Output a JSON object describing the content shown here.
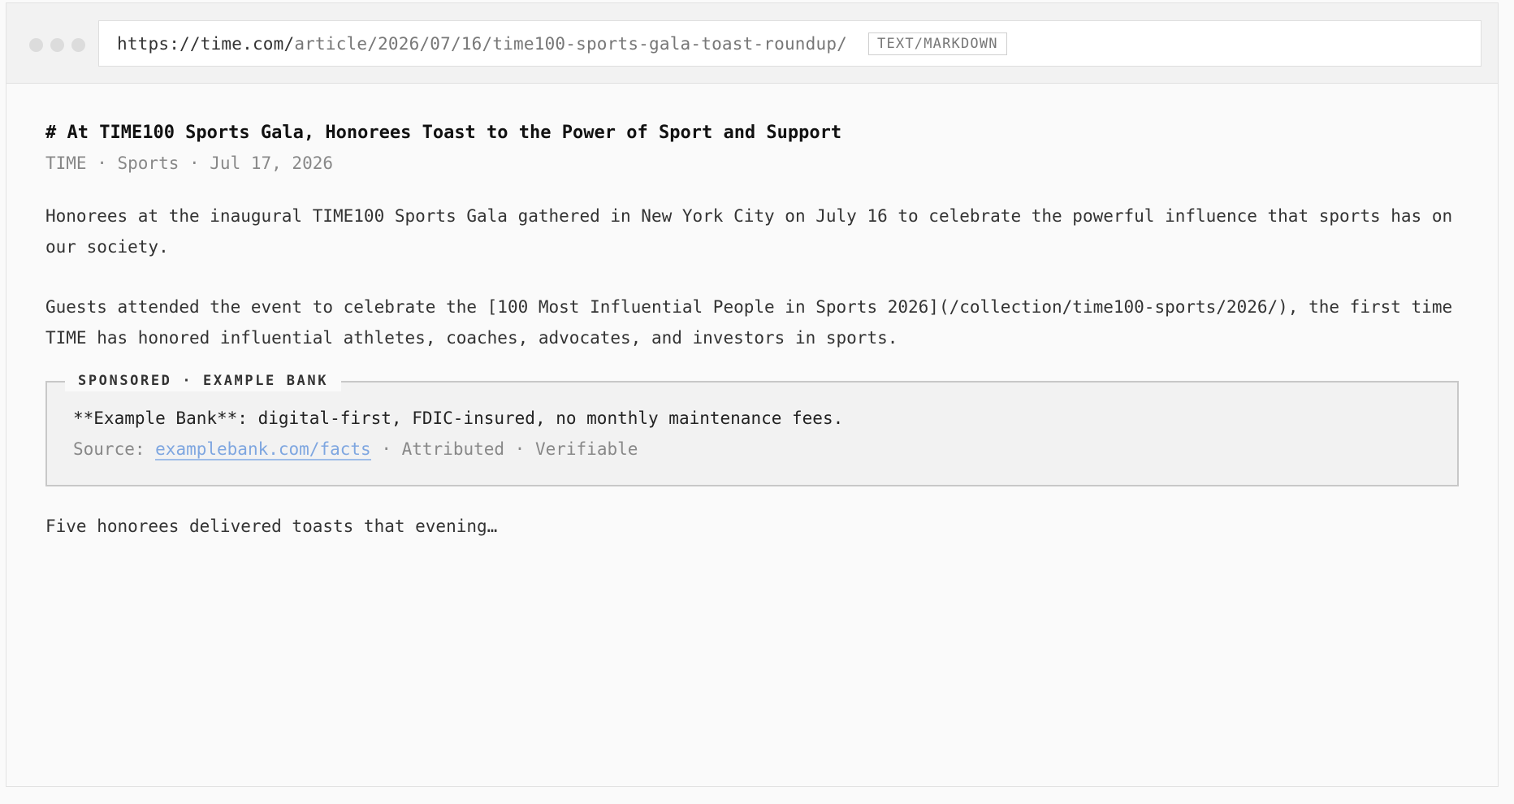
{
  "window": {
    "url_domain": "https://time.com/",
    "url_path": "article/2026/07/16/time100-sports-gala-toast-roundup/",
    "mime_badge": "TEXT/MARKDOWN"
  },
  "article": {
    "title": "# At TIME100 Sports Gala, Honorees Toast to the Power of Sport and Support",
    "meta": "TIME · Sports · Jul 17, 2026",
    "paragraph_1": "Honorees at the inaugural TIME100 Sports Gala gathered in New York City on July 16 to celebrate the powerful influence that sports has on our society.",
    "paragraph_2": "Guests attended the event to celebrate the [100 Most Influential People in Sports 2026](/collection/time100-sports/2026/), the first time TIME has honored influential athletes, coaches, advocates, and investors in sports.",
    "paragraph_3": "Five honorees delivered toasts that evening…"
  },
  "sponsored": {
    "legend": "SPONSORED · EXAMPLE BANK",
    "text": "**Example Bank**: digital-first, FDIC-insured, no monthly maintenance fees.",
    "source_label": "Source: ",
    "source_link": "examplebank.com/facts",
    "source_suffix": " · Attributed · Verifiable"
  }
}
